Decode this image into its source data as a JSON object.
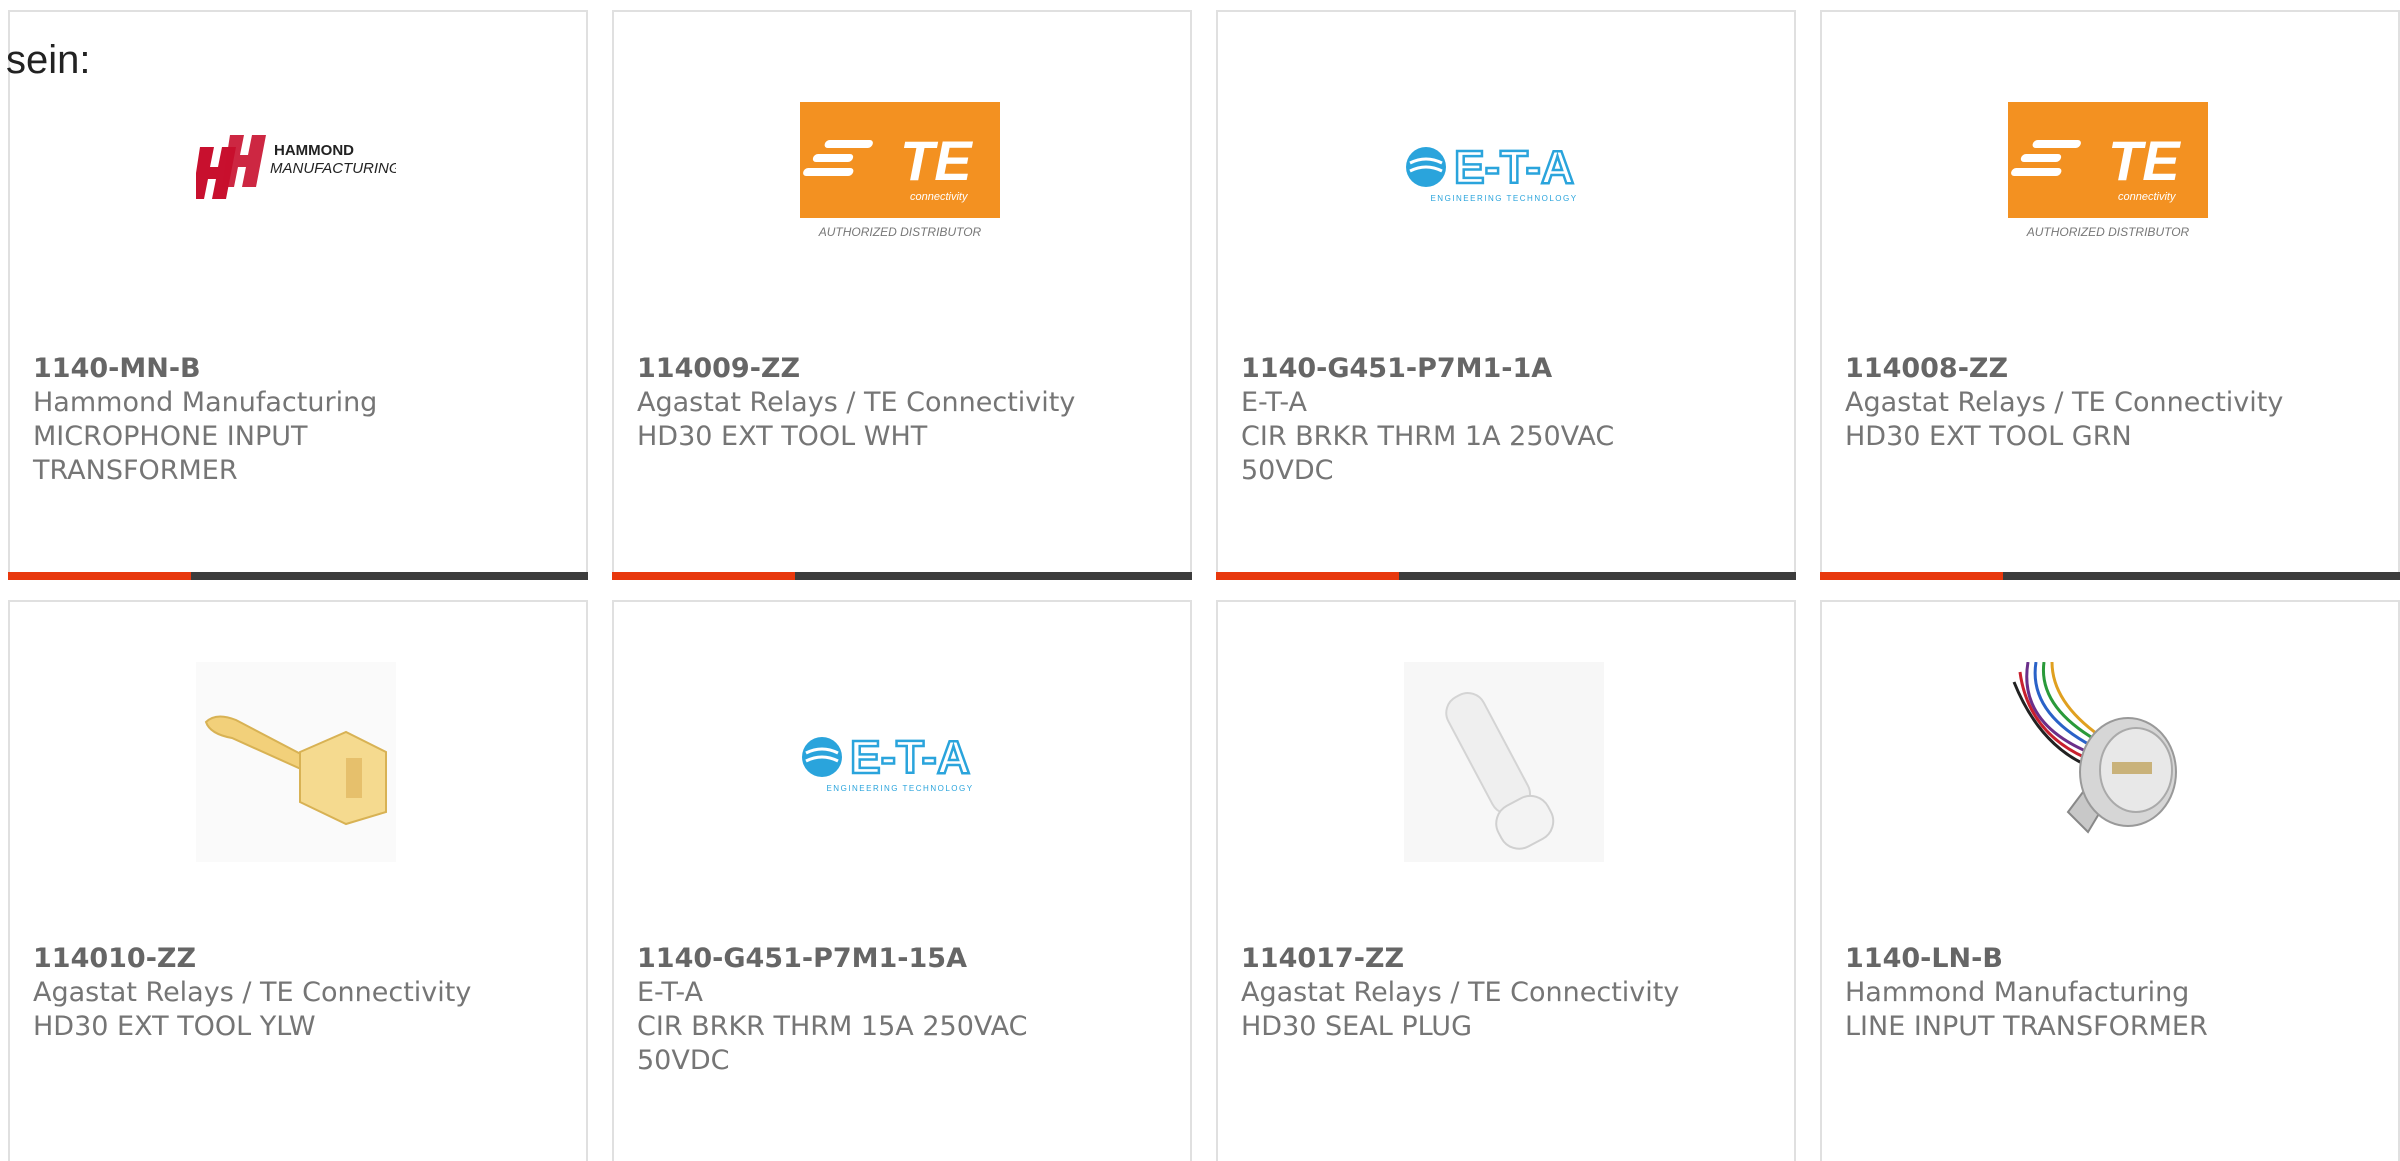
{
  "prefix_text": "sein:",
  "products": [
    {
      "part_number": "1140-MN-B",
      "manufacturer": "Hammond Manufacturing",
      "description": "MICROPHONE INPUT TRANSFORMER",
      "logo": "hammond-logo"
    },
    {
      "part_number": "114009-ZZ",
      "manufacturer": "Agastat Relays / TE Connectivity",
      "description": "HD30 EXT TOOL WHT",
      "logo": "te-connectivity-logo"
    },
    {
      "part_number": "1140-G451-P7M1-1A",
      "manufacturer": "E-T-A",
      "description": "CIR BRKR THRM 1A 250VAC 50VDC",
      "logo": "eta-logo"
    },
    {
      "part_number": "114008-ZZ",
      "manufacturer": "Agastat Relays / TE Connectivity",
      "description": "HD30 EXT TOOL GRN",
      "logo": "te-connectivity-logo"
    },
    {
      "part_number": "114010-ZZ",
      "manufacturer": "Agastat Relays / TE Connectivity",
      "description": "HD30 EXT TOOL YLW",
      "logo": "yellow-extraction-tool-photo"
    },
    {
      "part_number": "1140-G451-P7M1-15A",
      "manufacturer": "E-T-A",
      "description": "CIR BRKR THRM 15A 250VAC 50VDC",
      "logo": "eta-logo"
    },
    {
      "part_number": "114017-ZZ",
      "manufacturer": "Agastat Relays / TE Connectivity",
      "description": "HD30 SEAL PLUG",
      "logo": "seal-plug-photo"
    },
    {
      "part_number": "1140-LN-B",
      "manufacturer": "Hammond Manufacturing",
      "description": "LINE INPUT TRANSFORMER",
      "logo": "transformer-photo"
    }
  ],
  "logo_text": {
    "hammond_line1": "HAMMOND",
    "hammond_line2": "MANUFACTURING.",
    "te_main": "TE",
    "te_sub": "connectivity",
    "te_distributor": "AUTHORIZED DISTRIBUTOR",
    "eta_main": "E-T-A",
    "eta_sub": "ENGINEERING TECHNOLOGY"
  },
  "colors": {
    "accent": "#e8380d",
    "bar": "#3c3c3c",
    "te_orange": "#f39121",
    "eta_blue": "#2aa4dc",
    "hammond_red": "#c8102e"
  }
}
